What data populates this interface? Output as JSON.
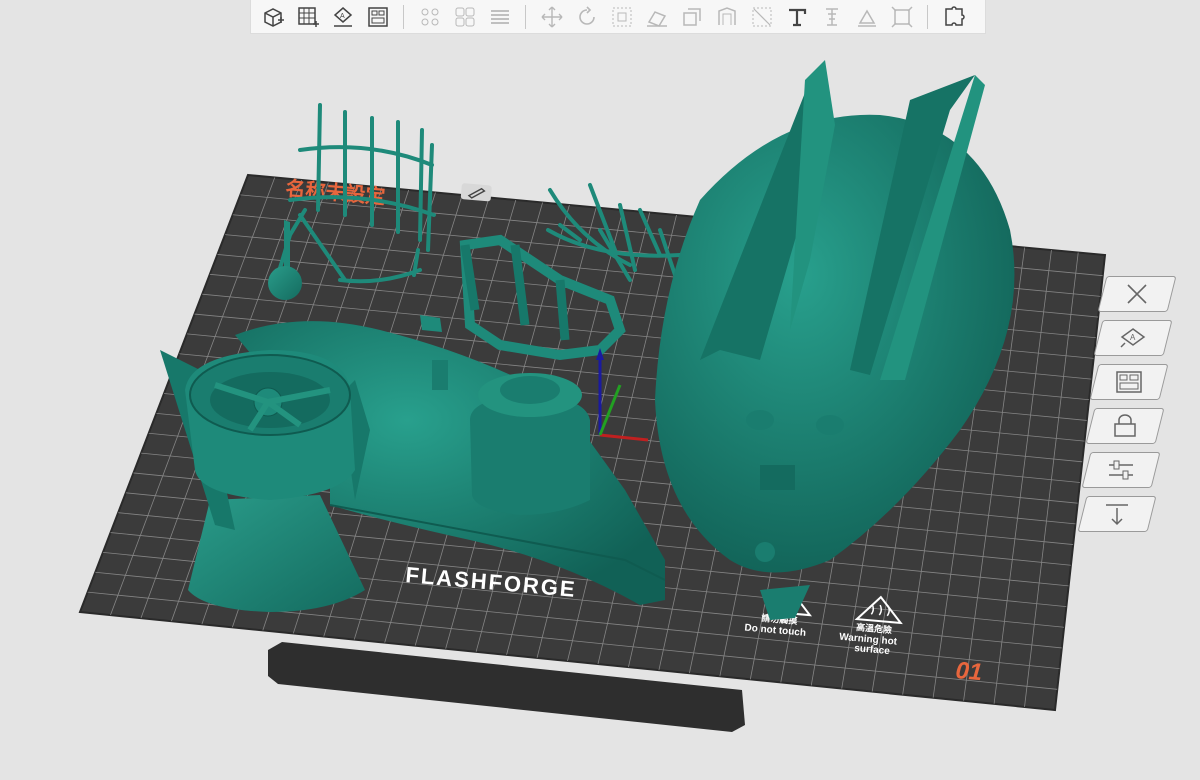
{
  "toolbar": {
    "groups": [
      [
        "add-model-icon",
        "add-grid-icon",
        "auto-place-icon",
        "layout-icon"
      ],
      [
        "arrange-icon",
        "group-icon",
        "layers-icon"
      ],
      [
        "move-icon",
        "rotate-icon",
        "scale-icon",
        "lay-flat-icon",
        "cut-icon",
        "hollow-icon",
        "measure-icon",
        "text-icon",
        "support-icon",
        "paint-icon",
        "fit-icon"
      ],
      [
        "puzzle-icon"
      ]
    ]
  },
  "plate": {
    "name_label": "名称未設定",
    "brand_label": "FLASHFORGE",
    "warning_touch": {
      "line1": "請勿觸摸",
      "line2": "Do not touch"
    },
    "warning_hot": {
      "line1": "高溫危險",
      "line2": "Warning hot",
      "line3": "surface"
    },
    "plate_number": "01"
  },
  "side_panel": {
    "buttons": [
      "close-icon",
      "auto-orient-icon",
      "arrange-panel-icon",
      "lock-icon",
      "settings-sliders-icon",
      "drop-to-bed-icon"
    ]
  },
  "colors": {
    "model": "#1e8a7a",
    "model_dark": "#0f5b50",
    "plate": "#3b3b3b",
    "grid": "#7a7a7a",
    "accent_text": "#e8663d"
  }
}
